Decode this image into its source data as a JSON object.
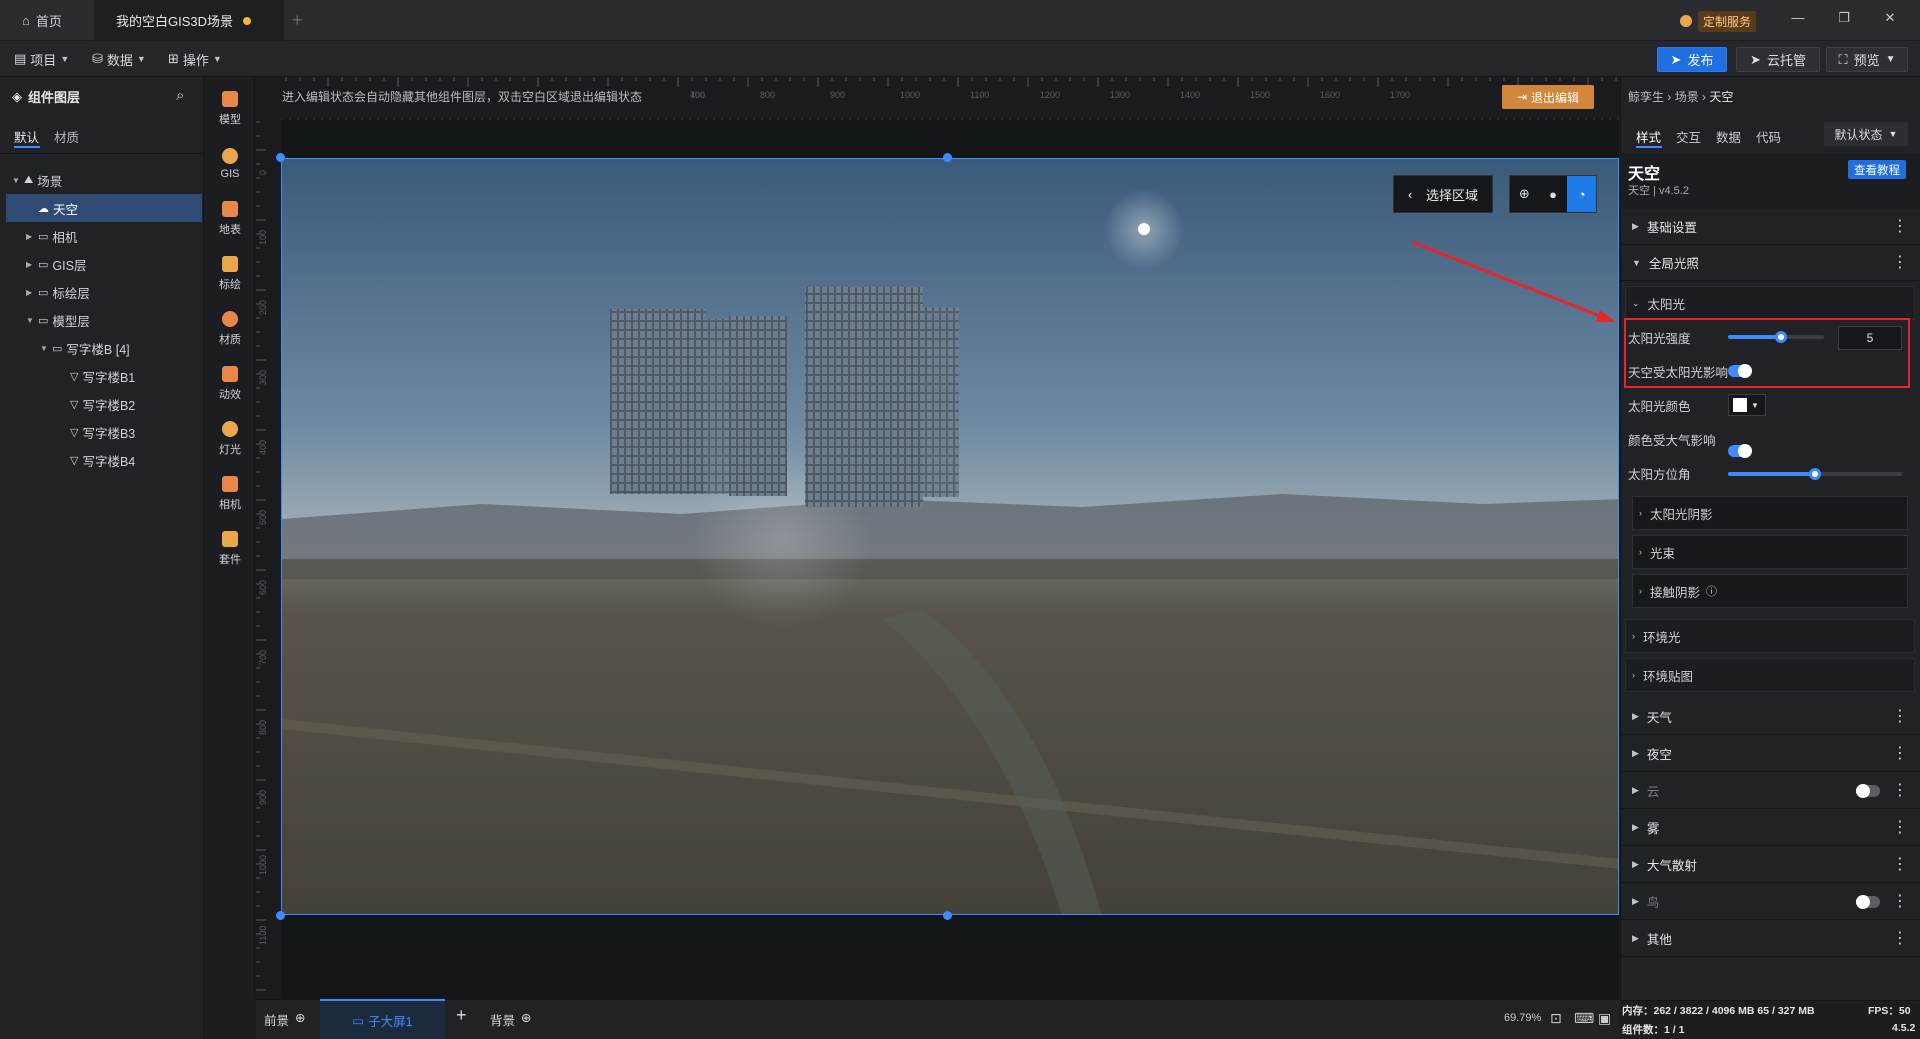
{
  "titlebar": {
    "home_tab": "首页",
    "project_tab": "我的空白GIS3D场景",
    "add_tab": "+",
    "custom_service": "定制服务",
    "win_min": "—",
    "win_max": "❐",
    "win_close": "✕"
  },
  "toolbar": {
    "menus": [
      "项目",
      "数据",
      "操作"
    ],
    "publish": "发布",
    "cloud": "云托管",
    "preview": "预览"
  },
  "layers": {
    "title": "组件图层",
    "tabs": [
      "默认",
      "材质"
    ],
    "items": [
      {
        "label": "场景",
        "level": 0,
        "expanded": true
      },
      {
        "label": "天空",
        "level": 1,
        "selected": true
      },
      {
        "label": "相机",
        "level": 1
      },
      {
        "label": "GIS层",
        "level": 1
      },
      {
        "label": "标绘层",
        "level": 1
      },
      {
        "label": "模型层",
        "level": 1,
        "expanded": true
      },
      {
        "label": "写字楼B [4]",
        "level": 2,
        "expanded": true
      },
      {
        "label": "写字楼B1",
        "level": 3
      },
      {
        "label": "写字楼B2",
        "level": 3
      },
      {
        "label": "写字楼B3",
        "level": 3
      },
      {
        "label": "写字楼B4",
        "level": 3
      }
    ]
  },
  "iconbar": [
    {
      "label": "模型",
      "icon": "model-icon"
    },
    {
      "label": "GIS",
      "icon": "gis-icon"
    },
    {
      "label": "地表",
      "icon": "terrain-icon"
    },
    {
      "label": "标绘",
      "icon": "marker-icon"
    },
    {
      "label": "材质",
      "icon": "material-icon"
    },
    {
      "label": "动效",
      "icon": "effect-icon"
    },
    {
      "label": "灯光",
      "icon": "light-icon"
    },
    {
      "label": "相机",
      "icon": "camera-icon"
    },
    {
      "label": "套件",
      "icon": "kit-icon"
    }
  ],
  "canvas": {
    "hint": "进入编辑状态会自动隐藏其他组件图层，双击空白区域退出编辑状态",
    "exit_edit": "退出编辑",
    "select_area": "选择区域",
    "ruler_h": [
      "400",
      "700",
      "800",
      "900",
      "1000",
      "1100",
      "1200",
      "1300",
      "1400",
      "1500",
      "1600",
      "1700"
    ],
    "ruler_v": [
      "0",
      "100",
      "200",
      "300",
      "400",
      "500",
      "600",
      "700",
      "800",
      "900",
      "1000",
      "1100"
    ]
  },
  "bottom": {
    "foreground": "前景",
    "screen_tab": "子大屏1",
    "add": "+",
    "background": "背景",
    "zoom": "69.79%"
  },
  "props": {
    "breadcrumb": [
      "鲸孪生",
      "场景",
      "天空"
    ],
    "tabs": [
      "样式",
      "交互",
      "数据",
      "代码"
    ],
    "state": "默认状态",
    "comp_title": "天空",
    "comp_sub": "天空 | v4.5.2",
    "tutorial": "查看教程",
    "sections_top": [
      "基础设置",
      "全局光照"
    ],
    "sun": "太阳光",
    "sun_intensity_label": "太阳光强度",
    "sun_intensity_value": "5",
    "sun_intensity_level": 0.55,
    "sky_affected_label": "天空受太阳光影响",
    "sun_color_label": "太阳光颜色",
    "color_affected_label": "颜色受大气影响",
    "azimuth_label": "太阳方位角",
    "azimuth_level": 0.5,
    "sub_sections": [
      "太阳光阴影",
      "光束",
      "接触阴影"
    ],
    "ambient": "环境光",
    "env_map": "环境贴图",
    "sections_bottom": [
      {
        "label": "天气",
        "toggle": false
      },
      {
        "label": "夜空",
        "toggle": false
      },
      {
        "label": "云",
        "toggle": true
      },
      {
        "label": "雾",
        "toggle": false
      },
      {
        "label": "大气散射",
        "toggle": false
      },
      {
        "label": "鸟",
        "toggle": true
      },
      {
        "label": "其他",
        "toggle": false
      }
    ]
  },
  "status": {
    "memory": "内存：262 / 3822 / 4096 MB  65 / 327 MB",
    "fps": "FPS：50",
    "components": "组件数：1 / 1",
    "version": "4.5.2"
  }
}
